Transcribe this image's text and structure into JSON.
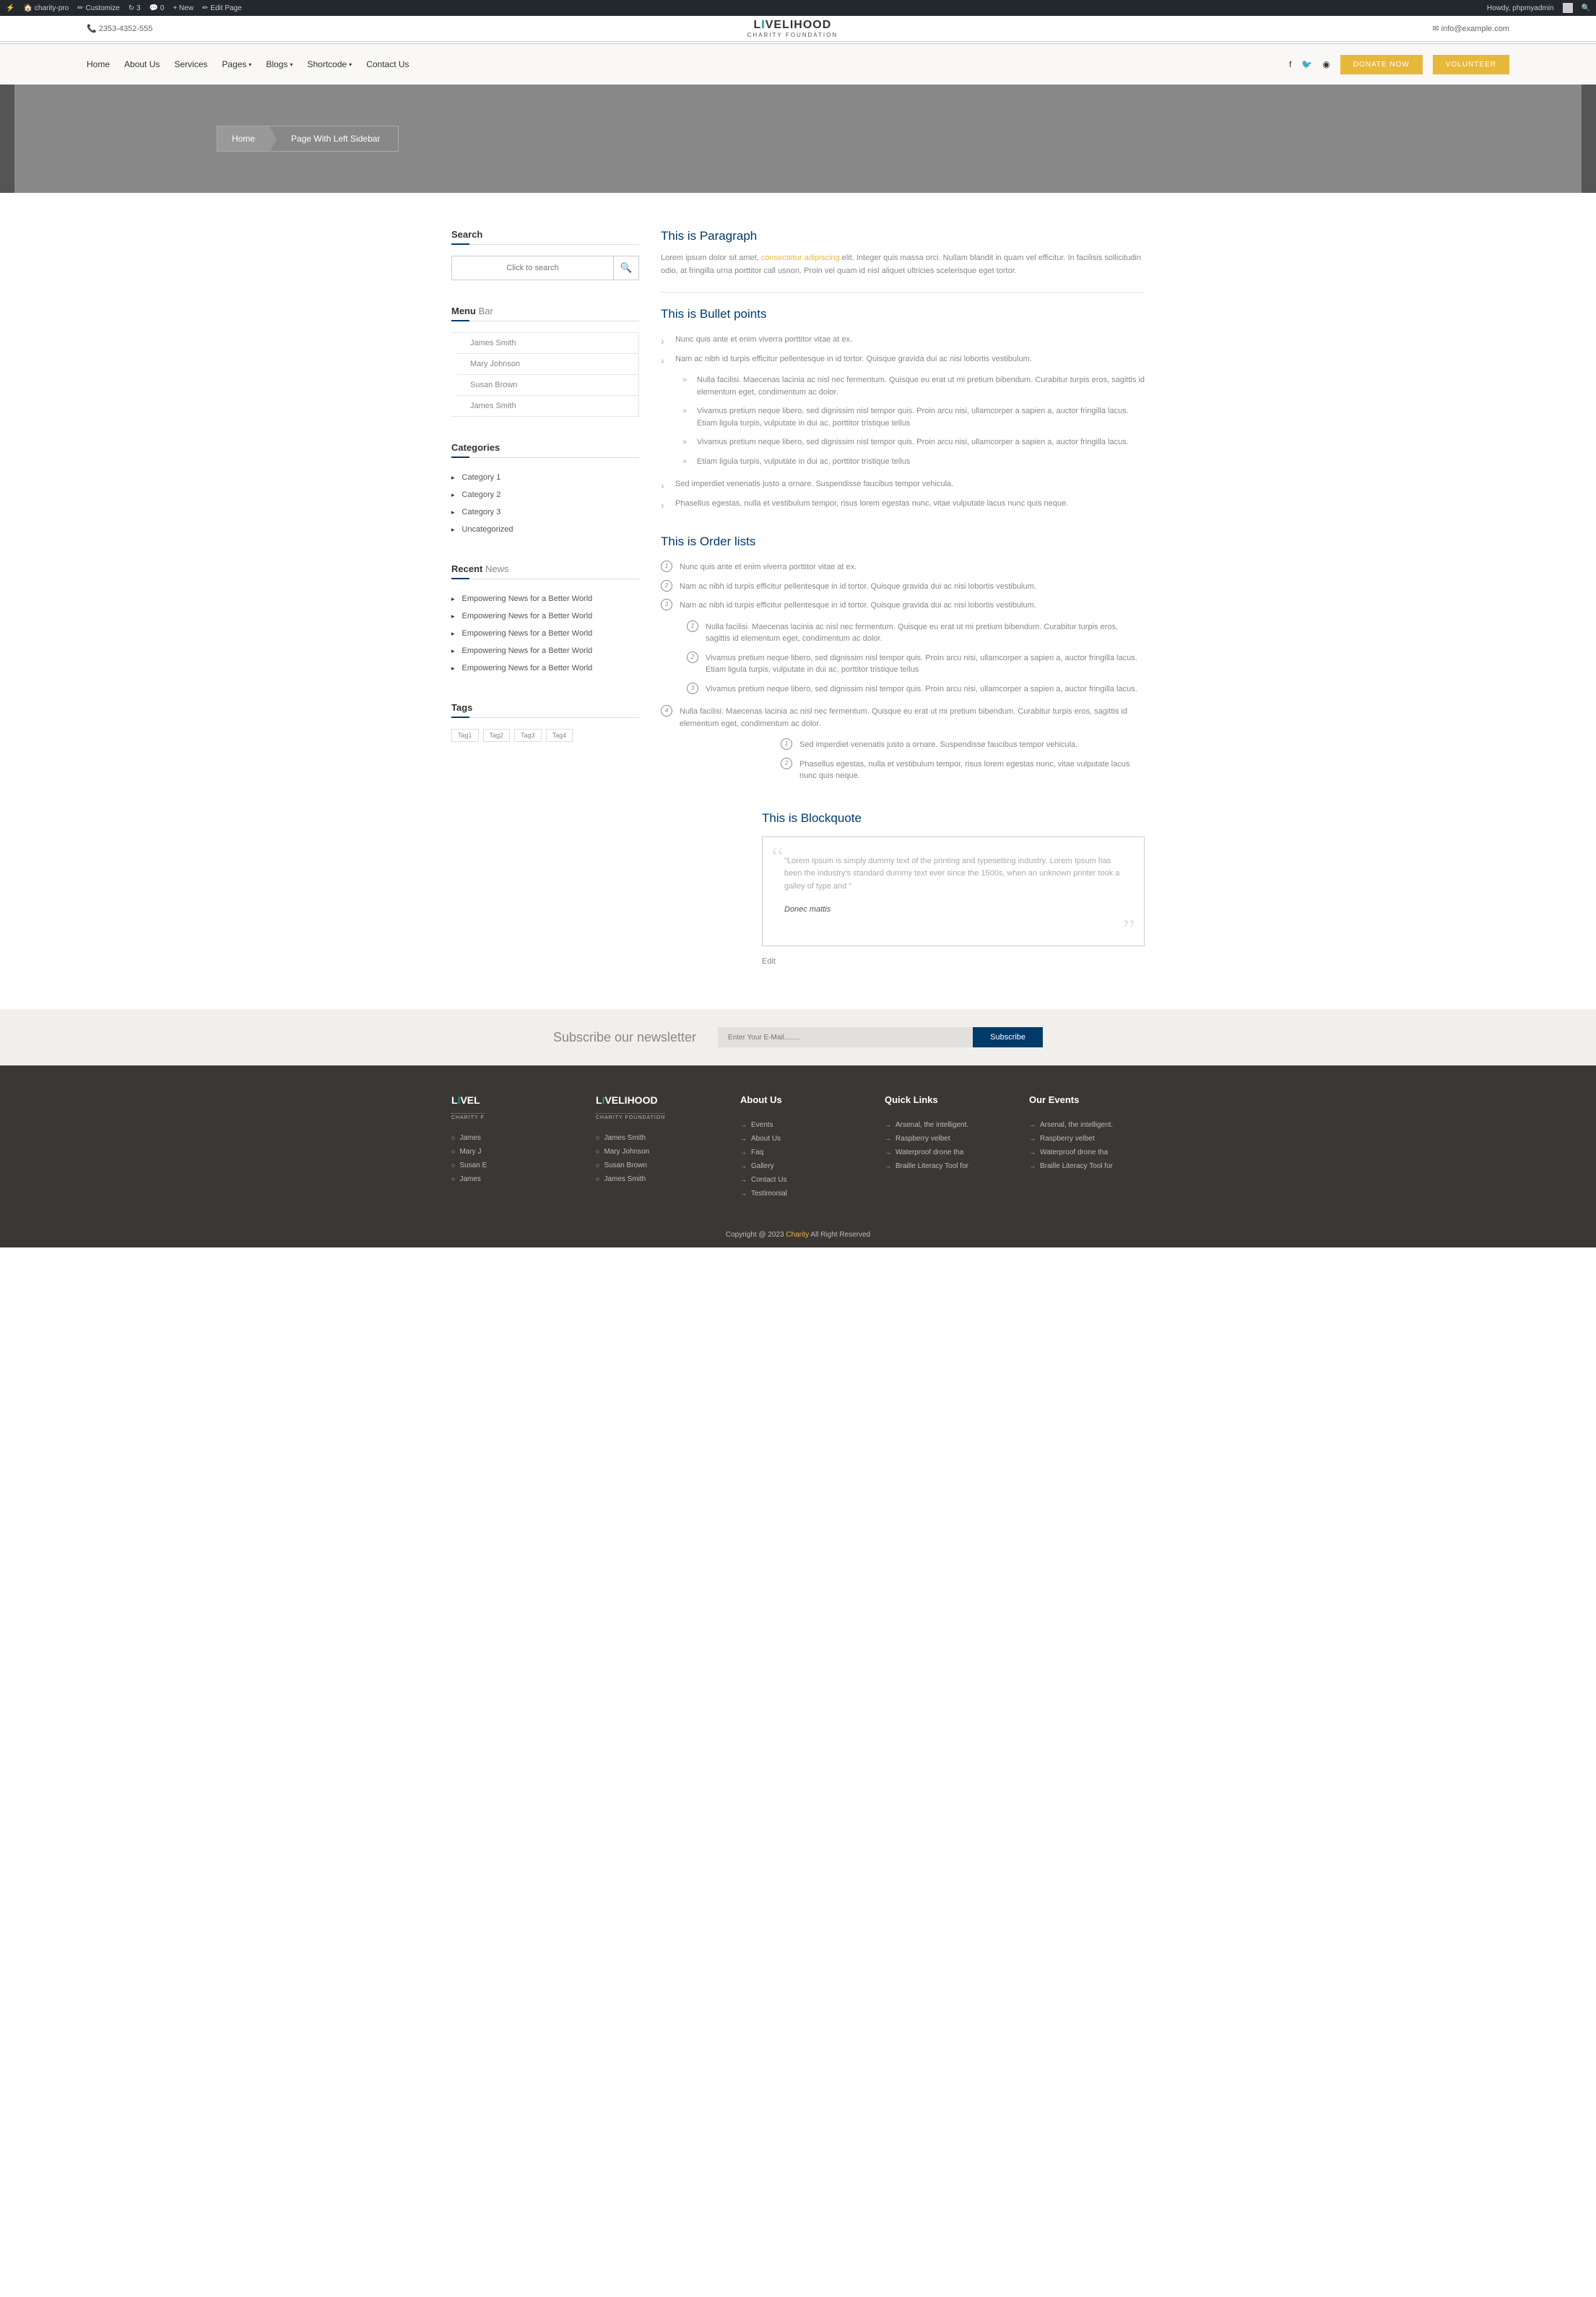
{
  "admin": {
    "left": [
      "⚡",
      "charity-pro",
      "Customize",
      "↻ 3",
      "💬 0",
      "+ New",
      "Edit Page"
    ],
    "right": "Howdy, phpmyadmin"
  },
  "contact": {
    "phone": "2353-4352-555",
    "email": "info@example.com"
  },
  "logo": {
    "pre": "L",
    "mid": "I",
    "post": "VELIHOOD",
    "sub": "CHARITY FOUNDATION"
  },
  "nav": {
    "items": [
      "Home",
      "About Us",
      "Services",
      "Pages",
      "Blogs",
      "Shortcode",
      "Contact Us"
    ],
    "dropdowns": [
      3,
      4,
      5
    ],
    "donate": "DONATE NOW",
    "volunteer": "VOLUNTEER"
  },
  "breadcrumb": {
    "home": "Home",
    "current": "Page With Left Sidebar"
  },
  "sidebar": {
    "search": {
      "title": "Search",
      "placeholder": "Click to search"
    },
    "menu": {
      "title_a": "Menu",
      "title_b": " Bar",
      "items": [
        "James Smith",
        "Mary Johnson",
        "Susan Brown",
        "James Smith"
      ]
    },
    "categories": {
      "title": "Categories",
      "items": [
        "Category 1",
        "Category 2",
        "Category 3",
        "Uncategorized"
      ]
    },
    "news": {
      "title_a": "Recent",
      "title_b": " News",
      "items": [
        "Empowering News for a Better World",
        "Empowering News for a Better World",
        "Empowering News for a Better World",
        "Empowering News for a Better World",
        "Empowering News for a Better World"
      ]
    },
    "tags": {
      "title": "Tags",
      "items": [
        "Tag1",
        "Tag2",
        "Tag3",
        "Tag4"
      ]
    }
  },
  "content": {
    "para": {
      "title": "This is Paragraph",
      "t1": "Lorem ipsum dolor sit amet, ",
      "link": "consectetur adipiscing",
      "t2": " elit. Integer quis massa orci. Nullam blandit in quam vel efficitur. In facilisis sollicitudin odio, at fringilla urna porttitor call usnon. Proin vel quam id nisl aliquet ultricies scelerisque eget tortor."
    },
    "bullets": {
      "title": "This is Bullet points",
      "items": [
        {
          "text": "Nunc quis ante et enim viverra porttitor vitae at ex."
        },
        {
          "text": "Nam ac nibh id turpis efficitur pellentesque in id tortor. Quisque gravida dui ac nisi lobortis vestibulum.",
          "sub": [
            "Nulla facilisi. Maecenas lacinia ac nisl nec fermentum. Quisque eu erat ut mi pretium bibendum. Curabitur turpis eros, sagittis id elementum eget, condimentum ac dolor.",
            "Vivamus pretium neque libero, sed dignissim nisl tempor quis. Proin arcu nisi, ullamcorper a sapien a, auctor fringilla lacus. Etiam ligula turpis, vulputate in dui ac, porttitor tristique tellus",
            "Vivamus pretium neque libero, sed dignissim nisl tempor quis. Proin arcu nisi, ullamcorper a sapien a, auctor fringilla lacus.",
            "Etiam ligula turpis, vulputate in dui ac, porttitor tristique tellus"
          ]
        },
        {
          "text": "Sed imperdiet venenatis justo a ornare. Suspendisse faucibus tempor vehicula."
        },
        {
          "text": "Phasellus egestas, nulla et vestibulum tempor, risus lorem egestas nunc, vitae vulputate lacus nunc quis neque."
        }
      ]
    },
    "order": {
      "title": "This is Order lists",
      "items": [
        {
          "text": "Nunc quis ante et enim viverra porttitor vitae at ex."
        },
        {
          "text": "Nam ac nibh id turpis efficitur pellentesque in id tortor. Quisque gravida dui ac nisi lobortis vestibulum."
        },
        {
          "text": "Nam ac nibh id turpis efficitur pellentesque in id tortor. Quisque gravida dui ac nisi lobortis vestibulum.",
          "sub": [
            "Nulla facilisi. Maecenas lacinia ac nisl nec fermentum. Quisque eu erat ut mi pretium bibendum. Curabitur turpis eros, sagittis id elementum eget, condimentum ac dolor.",
            "Vivamus pretium neque libero, sed dignissim nisl tempor quis. Proin arcu nisi, ullamcorper a sapien a, auctor fringilla lacus. Etiam ligula turpis, vulputate in dui ac, porttitor tristique tellus",
            "Vivamus pretium neque libero, sed dignissim nisl tempor quis. Proin arcu nisi, ullamcorper a sapien a, auctor fringilla lacus."
          ]
        },
        {
          "text": "Nulla facilisi. Maecenas lacinia ac nisl nec fermentum. Quisque eu erat ut mi pretium bibendum. Curabitur turpis eros, sagittis id elementum eget, condimentum ac dolor.",
          "offset_sub": [
            "Sed imperdiet venenatis justo a ornare. Suspendisse faucibus tempor vehicula.",
            "Phasellus egestas, nulla et vestibulum tempor, risus lorem egestas nunc, vitae vulputate lacus nunc quis neque."
          ]
        }
      ]
    },
    "blockquote": {
      "title": "This is Blockquote",
      "text": "\"Lorem Ipsum is simply dummy text of the printing and typesetting industry. Lorem Ipsum has been the industry's standard dummy text ever since the 1500s, when an unknown printer took a galley of type and \"",
      "author": "Donec mattis"
    },
    "edit": "Edit"
  },
  "newsletter": {
    "title": "Subscribe our newsletter",
    "placeholder": "Enter Your E-Mail........",
    "button": "Subscribe"
  },
  "footer": {
    "col1": {
      "items": [
        "James",
        "Mary J",
        "Susan E",
        "James"
      ]
    },
    "col2": {
      "items": [
        "James Smith",
        "Mary Johnson",
        "Susan Brown",
        "James Smith"
      ]
    },
    "about": {
      "title": "About Us",
      "items": [
        "Events",
        "About Us",
        "Faq",
        "Gallery",
        "Contact Us",
        "Testimonial"
      ]
    },
    "quick": {
      "title": "Quick Links",
      "items": [
        "Arsenal, the intelligent.",
        "Raspberry velbet",
        "Waterproof drone tha",
        "Braille Literacy Tool for"
      ]
    },
    "events": {
      "title": "Our Events",
      "items": [
        "Arsenal, the intelligent.",
        "Raspberry velbet",
        "Waterproof drone tha",
        "Braille Literacy Tool for"
      ]
    }
  },
  "copyright": {
    "t1": "Copyright @ 2023 ",
    "link": "Charity",
    "t2": " All Right Reserved"
  }
}
